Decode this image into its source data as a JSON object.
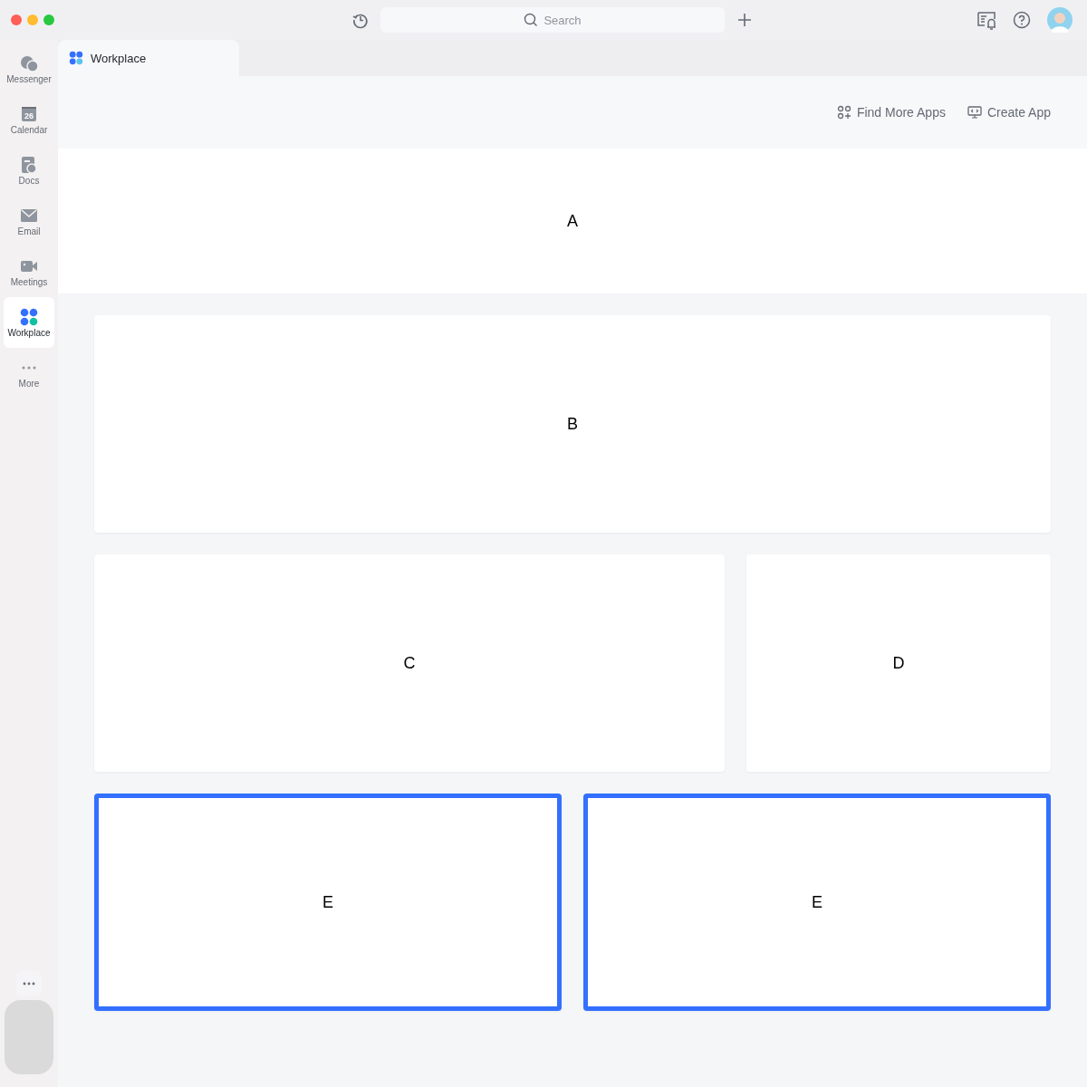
{
  "top_bar": {
    "search": {
      "placeholder": "Search"
    }
  },
  "sidebar": {
    "items": [
      {
        "label": "Messenger",
        "kind": "chat",
        "selected": false
      },
      {
        "label": "Calendar",
        "kind": "calendar",
        "icon_text": "26",
        "selected": false
      },
      {
        "label": "Docs",
        "kind": "doc",
        "selected": false
      },
      {
        "label": "Email",
        "kind": "mail",
        "selected": false
      },
      {
        "label": "Meetings",
        "kind": "video",
        "selected": false
      },
      {
        "label": "Workplace",
        "kind": "apps",
        "selected": true
      },
      {
        "label": "More",
        "kind": "dots",
        "selected": false
      }
    ]
  },
  "tabs": [
    {
      "label": "Workplace",
      "selected": true
    }
  ],
  "toolbar": {
    "buttons": [
      {
        "label": "Find More Apps",
        "kind": "add-apps"
      },
      {
        "label": "Create App",
        "kind": "create"
      }
    ]
  },
  "rows": [
    {
      "kind": "banner",
      "blocks": [
        {
          "label": "A",
          "highlighted": false
        }
      ]
    },
    {
      "kind": "cards",
      "blocks": [
        {
          "label": "B",
          "highlighted": false
        }
      ]
    },
    {
      "kind": "split",
      "blocks": [
        {
          "label": "C",
          "highlighted": false
        },
        {
          "label": "D",
          "highlighted": false
        }
      ]
    },
    {
      "kind": "cards",
      "blocks": [
        {
          "label": "E",
          "highlighted": true
        },
        {
          "label": "E",
          "highlighted": true
        }
      ]
    }
  ]
}
